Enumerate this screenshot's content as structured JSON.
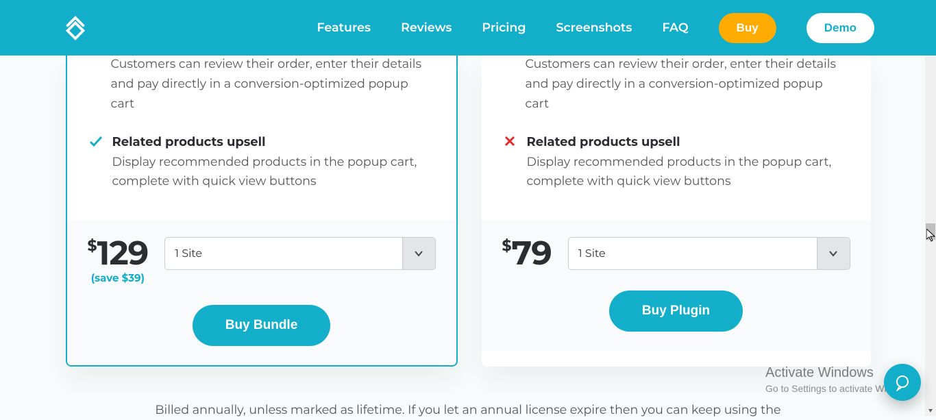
{
  "nav": {
    "features": "Features",
    "reviews": "Reviews",
    "pricing": "Pricing",
    "screenshots": "Screenshots",
    "faq": "FAQ",
    "buy": "Buy",
    "demo": "Demo"
  },
  "left": {
    "feat1_title": "",
    "feat1_body": "Customers can review their order, enter their details and pay directly in a conversion-optimized popup cart",
    "feat2_title": "Related products upsell",
    "feat2_body": "Display recommended products in the popup cart, complete with quick view buttons",
    "currency": "$",
    "price": "129",
    "save": "(save $39)",
    "siteSel": "1 Site",
    "cta": "Buy Bundle"
  },
  "right": {
    "feat1_title": "",
    "feat1_body": "Customers can review their order, enter their details and pay directly in a conversion-optimized popup cart",
    "feat2_title": "Related products upsell",
    "feat2_body": "Display recommended products in the popup cart, complete with quick view buttons",
    "currency": "$",
    "price": "79",
    "siteSel": "1 Site",
    "cta": "Buy Plugin"
  },
  "footnote": "Billed annually, unless marked as lifetime. If you let an annual license expire then you can keep using the",
  "wm": {
    "title": "Activate Windows",
    "sub": "Go to Settings to activate Windows."
  }
}
